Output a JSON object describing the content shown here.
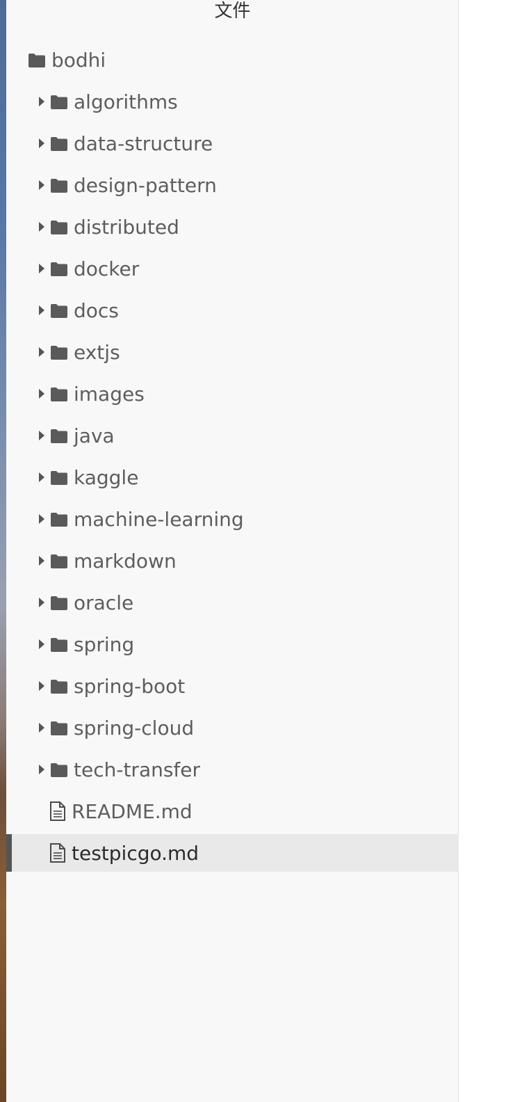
{
  "sidebar": {
    "title": "文件",
    "root": {
      "name": "bodhi",
      "icon": "folder-icon"
    },
    "folders": [
      {
        "name": "algorithms"
      },
      {
        "name": "data-structure"
      },
      {
        "name": "design-pattern"
      },
      {
        "name": "distributed"
      },
      {
        "name": "docker"
      },
      {
        "name": "docs"
      },
      {
        "name": "extjs"
      },
      {
        "name": "images"
      },
      {
        "name": "java"
      },
      {
        "name": "kaggle"
      },
      {
        "name": "machine-learning"
      },
      {
        "name": "markdown"
      },
      {
        "name": "oracle"
      },
      {
        "name": "spring"
      },
      {
        "name": "spring-boot"
      },
      {
        "name": "spring-cloud"
      },
      {
        "name": "tech-transfer"
      }
    ],
    "files": [
      {
        "name": "README.md",
        "active": false
      },
      {
        "name": "testpicgo.md",
        "active": true
      }
    ]
  },
  "colors": {
    "sidebar_bg": "#f8f8f8",
    "active_bg": "#e9e9e9",
    "active_marker": "#555555",
    "text": "#5d5d5d"
  }
}
